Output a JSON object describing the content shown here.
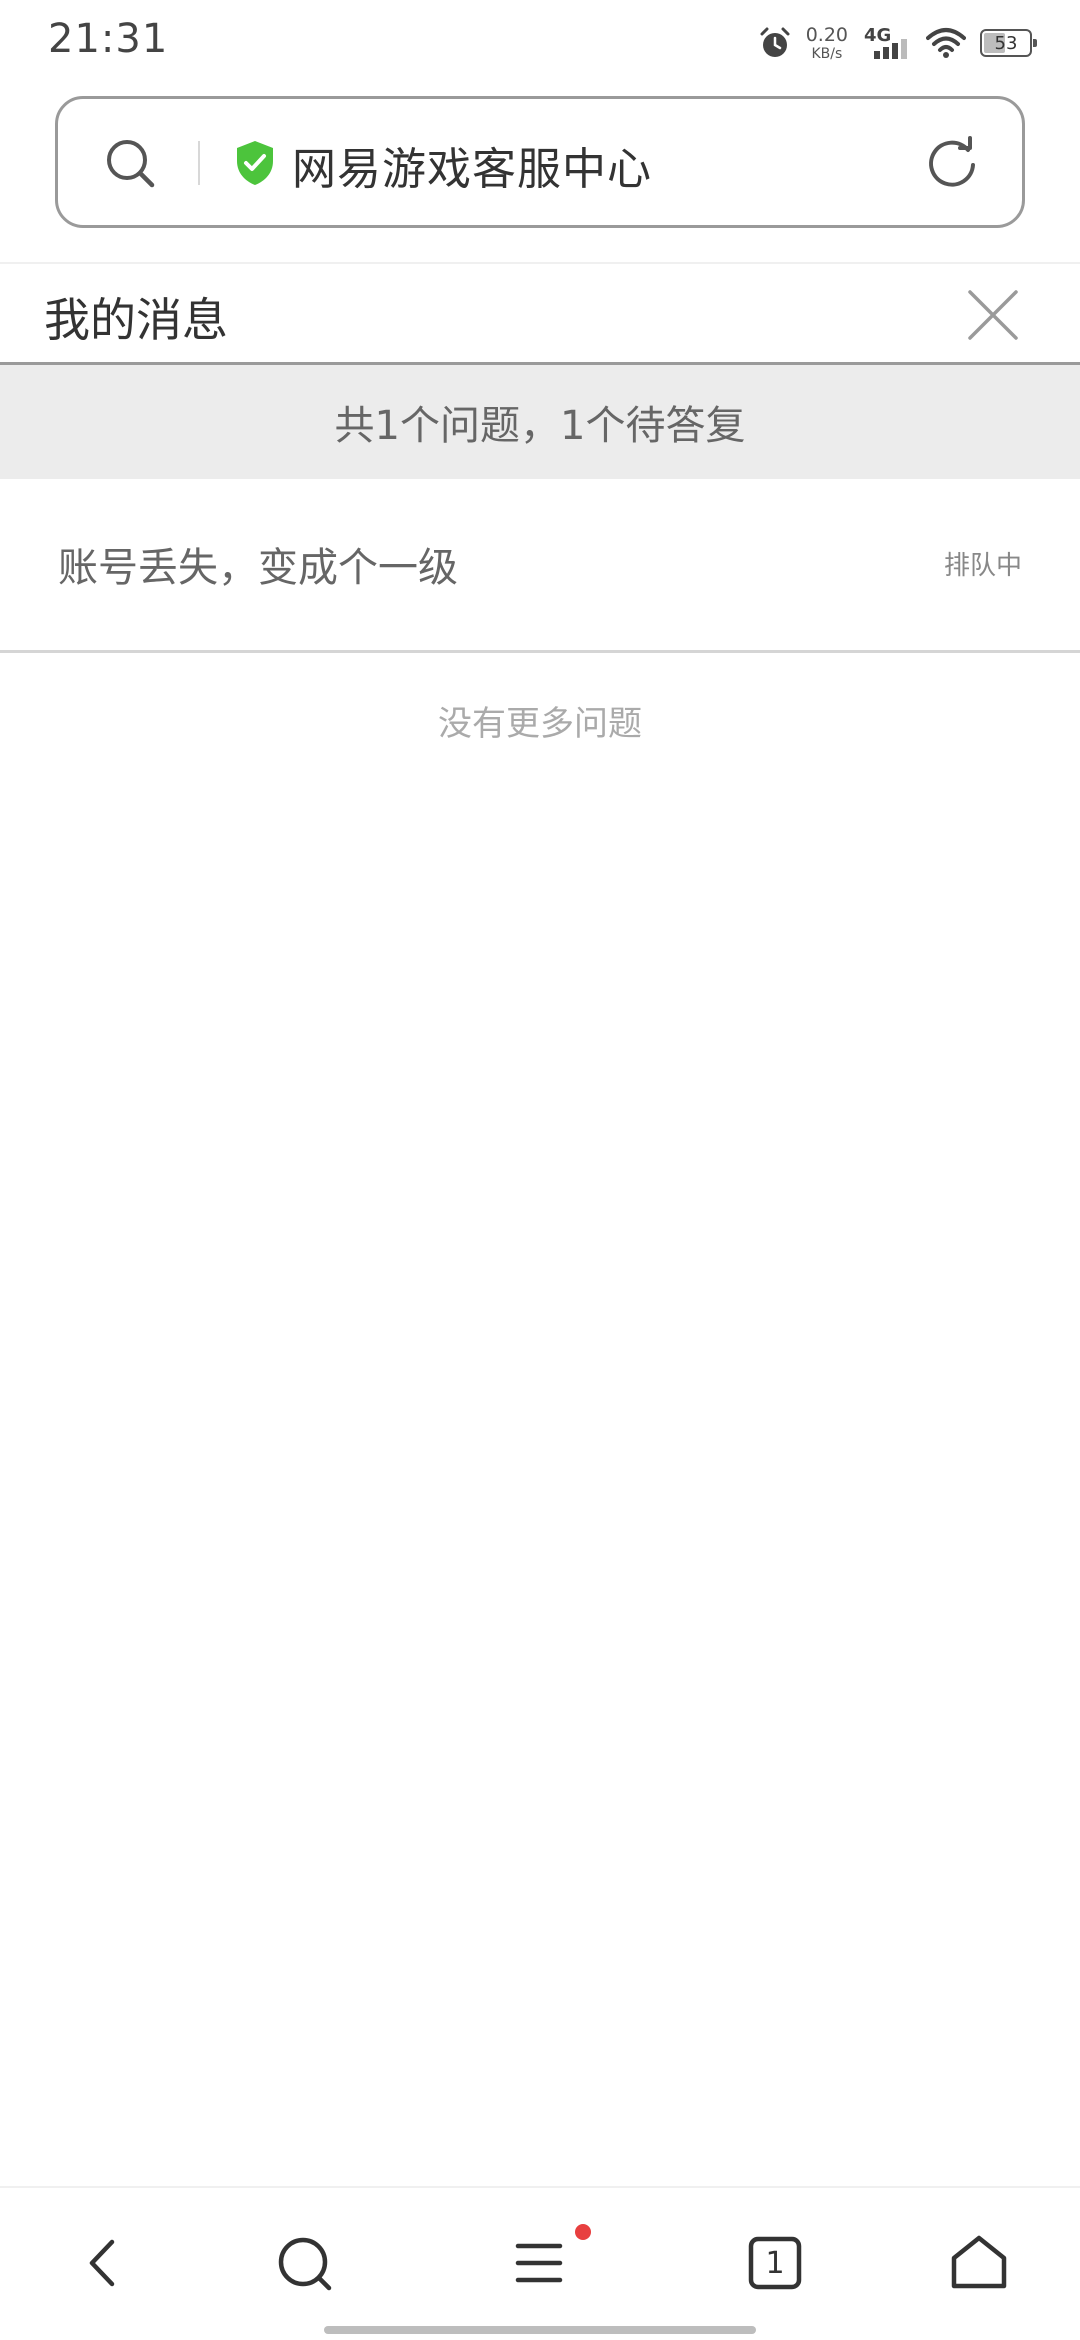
{
  "status_bar": {
    "time": "21:31",
    "net_speed_value": "0.20",
    "net_speed_unit": "KB/s",
    "network_type": "4G",
    "battery_level": "53",
    "battery_percent": 53,
    "icons": [
      "alarm-icon",
      "signal-icon",
      "wifi-icon",
      "battery-icon"
    ]
  },
  "address_bar": {
    "title": "网易游戏客服中心",
    "security_color": "#4cc43c",
    "icons": [
      "search-icon",
      "shield-check-icon",
      "reload-icon"
    ]
  },
  "panel": {
    "title": "我的消息",
    "summary": "共1个问题，1个待答复",
    "questions": [
      {
        "text": "账号丢失，变成个一级",
        "status": "排队中"
      }
    ],
    "no_more_text": "没有更多问题"
  },
  "bottom_nav": {
    "tab_count": "1",
    "menu_badge_color": "#e83f3f",
    "icons": [
      "back-icon",
      "search-icon",
      "menu-icon",
      "tabs-icon",
      "home-icon"
    ]
  }
}
